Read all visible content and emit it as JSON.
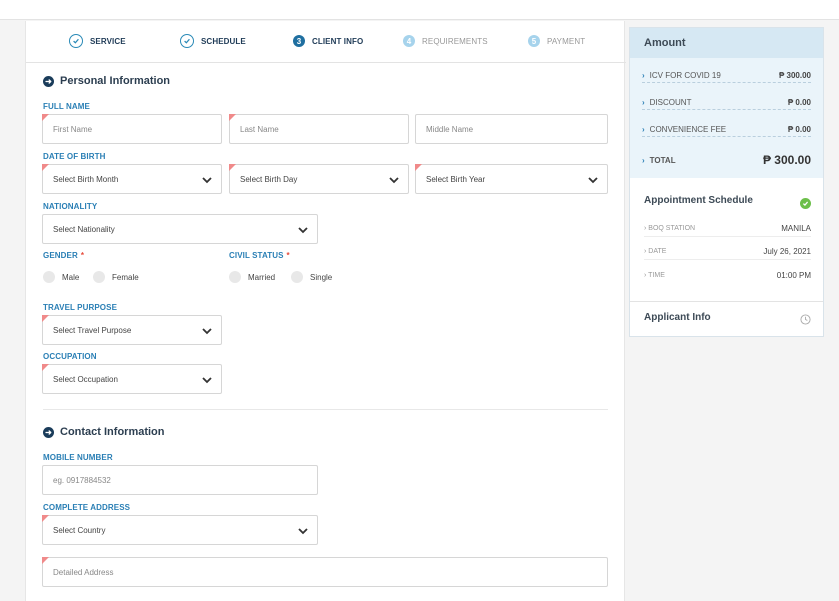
{
  "steps": [
    {
      "num": "",
      "label": "SERVICE",
      "state": "done"
    },
    {
      "num": "",
      "label": "SCHEDULE",
      "state": "done"
    },
    {
      "num": "3",
      "label": "CLIENT INFO",
      "state": "active"
    },
    {
      "num": "4",
      "label": "REQUIREMENTS",
      "state": "pending"
    },
    {
      "num": "5",
      "label": "PAYMENT",
      "state": "pending"
    }
  ],
  "personal": {
    "title": "Personal Information",
    "full_name_label": "FULL NAME",
    "first_name_placeholder": "First Name",
    "last_name_placeholder": "Last Name",
    "middle_name_placeholder": "Middle Name",
    "dob_label": "DATE OF BIRTH",
    "birth_month": "Select Birth Month",
    "birth_day": "Select Birth Day",
    "birth_year": "Select Birth Year",
    "nationality_label": "NATIONALITY",
    "nationality": "Select Nationality",
    "gender_label": "GENDER",
    "gender_options": [
      "Male",
      "Female"
    ],
    "civil_label": "CIVIL STATUS",
    "civil_options": [
      "Married",
      "Single"
    ],
    "required_mark": "*",
    "travel_label": "TRAVEL PURPOSE",
    "travel": "Select Travel Purpose",
    "occupation_label": "OCCUPATION",
    "occupation": "Select Occupation"
  },
  "contact": {
    "title": "Contact Information",
    "mobile_label": "MOBILE NUMBER",
    "mobile_placeholder": "eg. 0917884532",
    "address_label": "COMPLETE ADDRESS",
    "country": "Select Country",
    "detailed_placeholder": "Detailed Address"
  },
  "amount": {
    "title": "Amount",
    "rows": [
      {
        "label": "ICV FOR COVID 19",
        "value": "₱ 300.00"
      },
      {
        "label": "DISCOUNT",
        "value": "₱ 0.00"
      },
      {
        "label": "CONVENIENCE FEE",
        "value": "₱ 0.00"
      },
      {
        "label": "TOTAL",
        "value": "₱ 300.00"
      }
    ]
  },
  "schedule": {
    "title": "Appointment Schedule",
    "rows": [
      {
        "label": "BOQ STATION",
        "value": "MANILA"
      },
      {
        "label": "DATE",
        "value": "July 26, 2021"
      },
      {
        "label": "TIME",
        "value": "01:00 PM"
      }
    ]
  },
  "applicant": {
    "title": "Applicant Info"
  },
  "colors": {
    "accent": "#2a7fb5",
    "required": "#e74c3c",
    "success": "#6cbf4a"
  }
}
